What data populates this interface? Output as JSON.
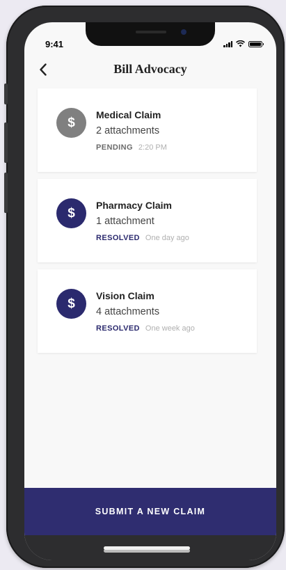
{
  "status_bar": {
    "time": "9:41"
  },
  "header": {
    "title": "Bill Advocacy"
  },
  "claims": [
    {
      "title": "Medical Claim",
      "attachments": "2 attachments",
      "status": "PENDING",
      "time": "2:20 PM",
      "icon_color": "#808080",
      "status_color": "#6b6b6b",
      "icon": "dollar-icon"
    },
    {
      "title": "Pharmacy Claim",
      "attachments": "1 attachment",
      "status": "RESOLVED",
      "time": "One day ago",
      "icon_color": "#2b2a6e",
      "status_color": "#2b2a6e",
      "icon": "dollar-icon"
    },
    {
      "title": "Vision Claim",
      "attachments": "4 attachments",
      "status": "RESOLVED",
      "time": "One week ago",
      "icon_color": "#2b2a6e",
      "status_color": "#2b2a6e",
      "icon": "dollar-icon"
    }
  ],
  "cta": {
    "label": "SUBMIT A NEW CLAIM",
    "color": "#2f2d70"
  },
  "icons": {
    "coin_glyph": "$"
  }
}
